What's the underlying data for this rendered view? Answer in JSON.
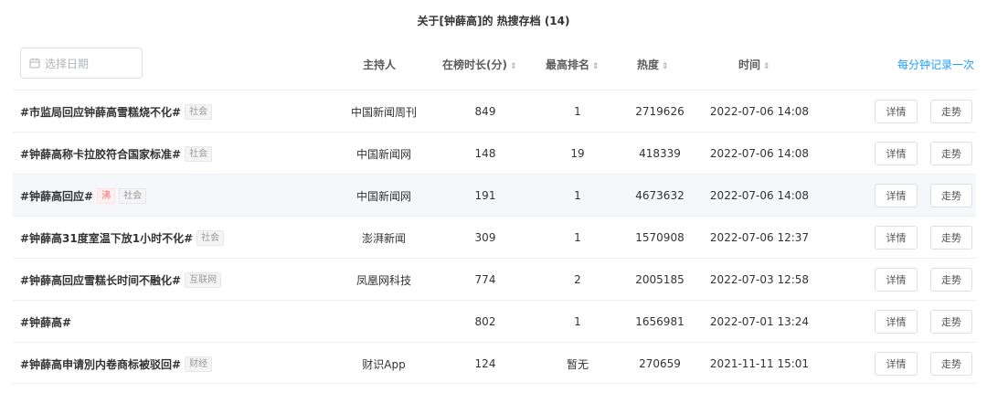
{
  "page": {
    "title": "关于[钟薛高]的 热搜存档 (14)"
  },
  "toolbar": {
    "date_placeholder": "选择日期",
    "icon": "calendar-icon",
    "record_link": "每分钟记录一次"
  },
  "table": {
    "headers": {
      "host": "主持人",
      "duration": "在榜时长(分)",
      "rank": "最高排名",
      "heat": "热度",
      "time": "时间"
    },
    "sort_glyph": "⇕",
    "detail_label": "详情",
    "trend_label": "走势",
    "rows": [
      {
        "topic": "#市监局回应钟薛高雪糕烧不化#",
        "badge": "",
        "tag": "社会",
        "host": "中国新闻周刊",
        "duration": "849",
        "rank": "1",
        "heat": "2719626",
        "time": "2022-07-06 14:08"
      },
      {
        "topic": "#钟薛高称卡拉胶符合国家标准#",
        "badge": "",
        "tag": "社会",
        "host": "中国新闻网",
        "duration": "148",
        "rank": "19",
        "heat": "418339",
        "time": "2022-07-06 14:08"
      },
      {
        "topic": "#钟薛高回应#",
        "badge": "沸",
        "tag": "社会",
        "host": "中国新闻网",
        "duration": "191",
        "rank": "1",
        "heat": "4673632",
        "time": "2022-07-06 14:08"
      },
      {
        "topic": "#钟薛高31度室温下放1小时不化#",
        "badge": "",
        "tag": "社会",
        "host": "澎湃新闻",
        "duration": "309",
        "rank": "1",
        "heat": "1570908",
        "time": "2022-07-06 12:37"
      },
      {
        "topic": "#钟薛高回应雪糕长时间不融化#",
        "badge": "",
        "tag": "互联网",
        "host": "凤凰网科技",
        "duration": "774",
        "rank": "2",
        "heat": "2005185",
        "time": "2022-07-03 12:58"
      },
      {
        "topic": "#钟薛高#",
        "badge": "",
        "tag": "",
        "host": "",
        "duration": "802",
        "rank": "1",
        "heat": "1656981",
        "time": "2022-07-01 13:24"
      },
      {
        "topic": "#钟薛高申请別内卷商标被驳回#",
        "badge": "",
        "tag": "财经",
        "host": "财识App",
        "duration": "124",
        "rank": "暂无",
        "heat": "270659",
        "time": "2021-11-11 15:01"
      }
    ],
    "highlight_row": 2
  },
  "colors": {
    "link": "#1e9fff",
    "hot_badge": "#f56c6c",
    "row_highlight": "#f5f7fa"
  }
}
